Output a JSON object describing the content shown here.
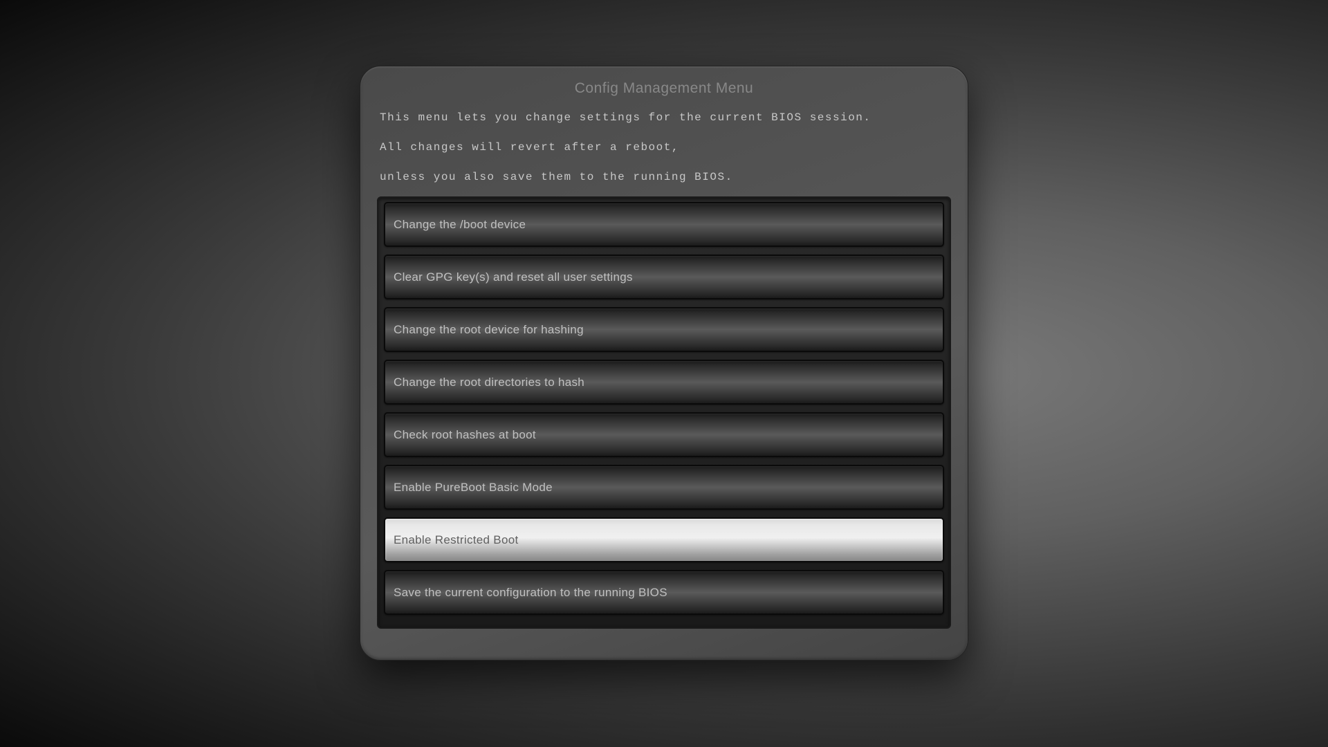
{
  "panel": {
    "title": "Config Management Menu",
    "description": {
      "line1": "This menu lets you change settings for the current BIOS session.",
      "line2": "All changes will revert after a reboot,",
      "line3": "unless you also save them to the running BIOS."
    }
  },
  "menu": {
    "items": [
      {
        "label": "Change the /boot device",
        "selected": false
      },
      {
        "label": "Clear GPG key(s) and reset all user settings",
        "selected": false
      },
      {
        "label": "Change the root device for hashing",
        "selected": false
      },
      {
        "label": "Change the root directories to hash",
        "selected": false
      },
      {
        "label": "Check root hashes at boot",
        "selected": false
      },
      {
        "label": "Enable PureBoot Basic Mode",
        "selected": false
      },
      {
        "label": "Enable Restricted Boot",
        "selected": true
      },
      {
        "label": "Save the current configuration to the running BIOS",
        "selected": false
      }
    ]
  }
}
